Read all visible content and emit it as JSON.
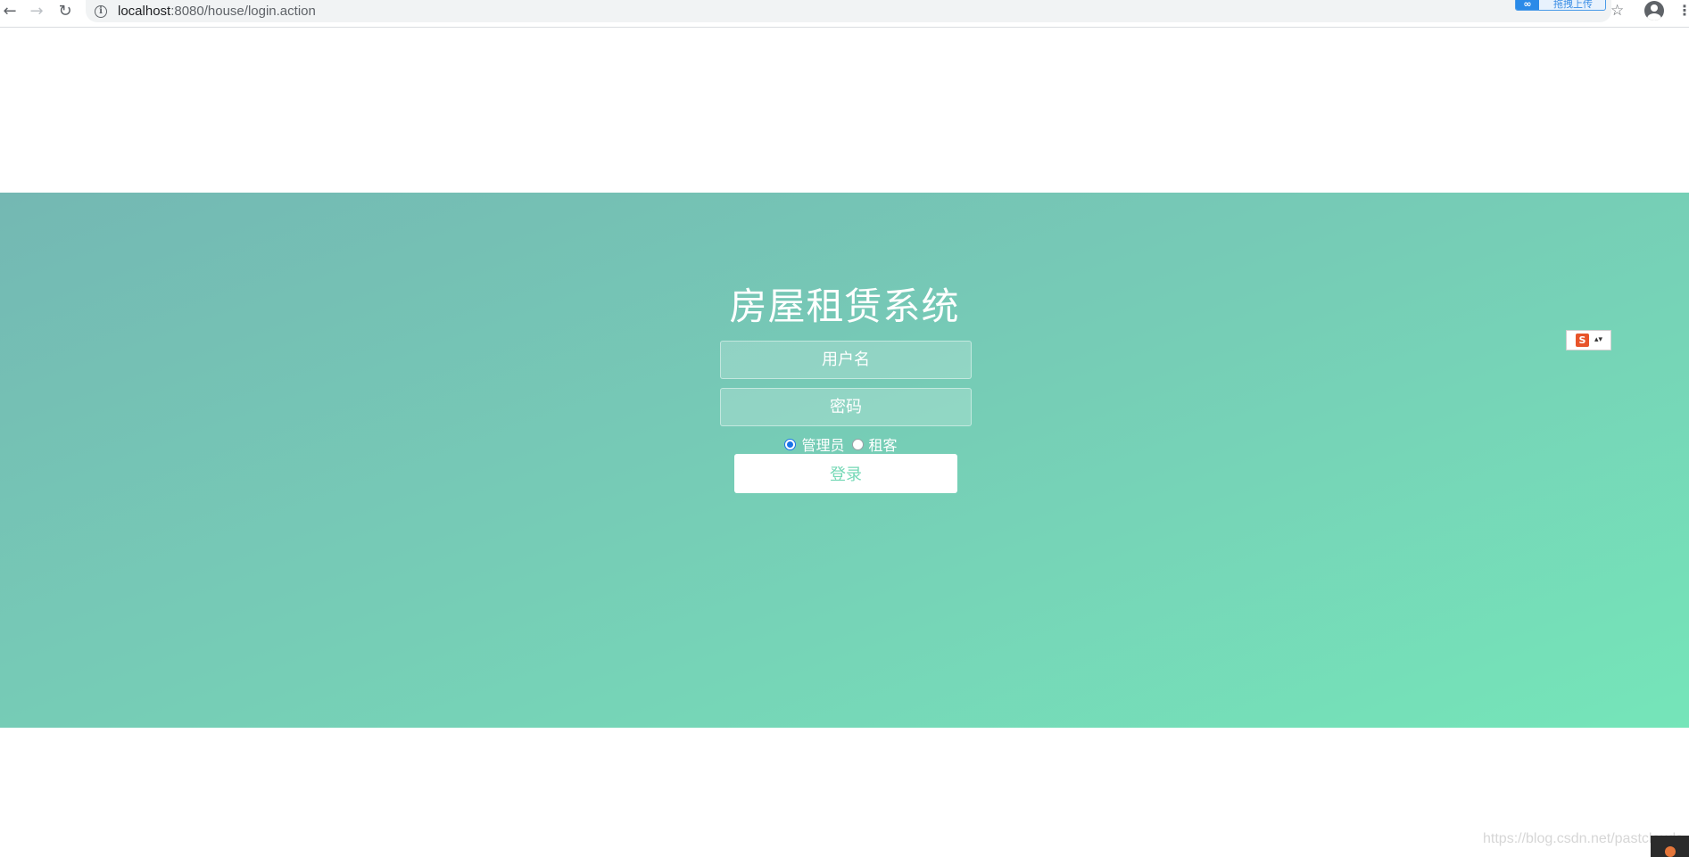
{
  "browser": {
    "url_host": "localhost",
    "url_rest": ":8080/house/login.action",
    "extension_label": "拖拽上传",
    "icons": {
      "back": "arrow-left-icon",
      "forward": "arrow-right-icon",
      "reload": "reload-icon",
      "info": "info-icon",
      "bookmark": "star-icon",
      "profile": "profile-icon",
      "menu": "kebab-menu-icon"
    }
  },
  "login": {
    "title": "房屋租赁系统",
    "username_placeholder": "用户名",
    "password_placeholder": "密码",
    "roles": [
      {
        "label": "管理员",
        "checked": true
      },
      {
        "label": "租客",
        "checked": false
      }
    ],
    "submit_label": "登录"
  },
  "ime": {
    "logo_text": "S",
    "arrow": "▴▾"
  },
  "watermark": "https://blog.csdn.net/pastclouds",
  "colors": {
    "gradient_start": "#74b8b3",
    "gradient_end": "#75e5b9",
    "button_text": "#75d8b6"
  }
}
